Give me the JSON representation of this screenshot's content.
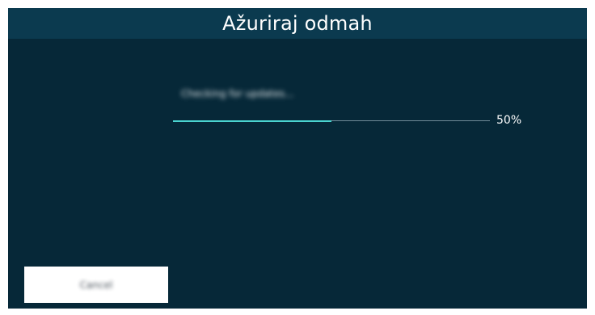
{
  "window": {
    "title": "Ažuriraj odmah"
  },
  "update": {
    "status_text": "Checking for updates...",
    "progress_percent": 50,
    "progress_label": "50%"
  },
  "actions": {
    "cancel_label": "Cancel"
  },
  "colors": {
    "title_bar": "#0b3a4f",
    "background": "#062838",
    "progress_fill": "#4ad4d0",
    "progress_track": "#6f8a98",
    "button": "#ffffff"
  }
}
